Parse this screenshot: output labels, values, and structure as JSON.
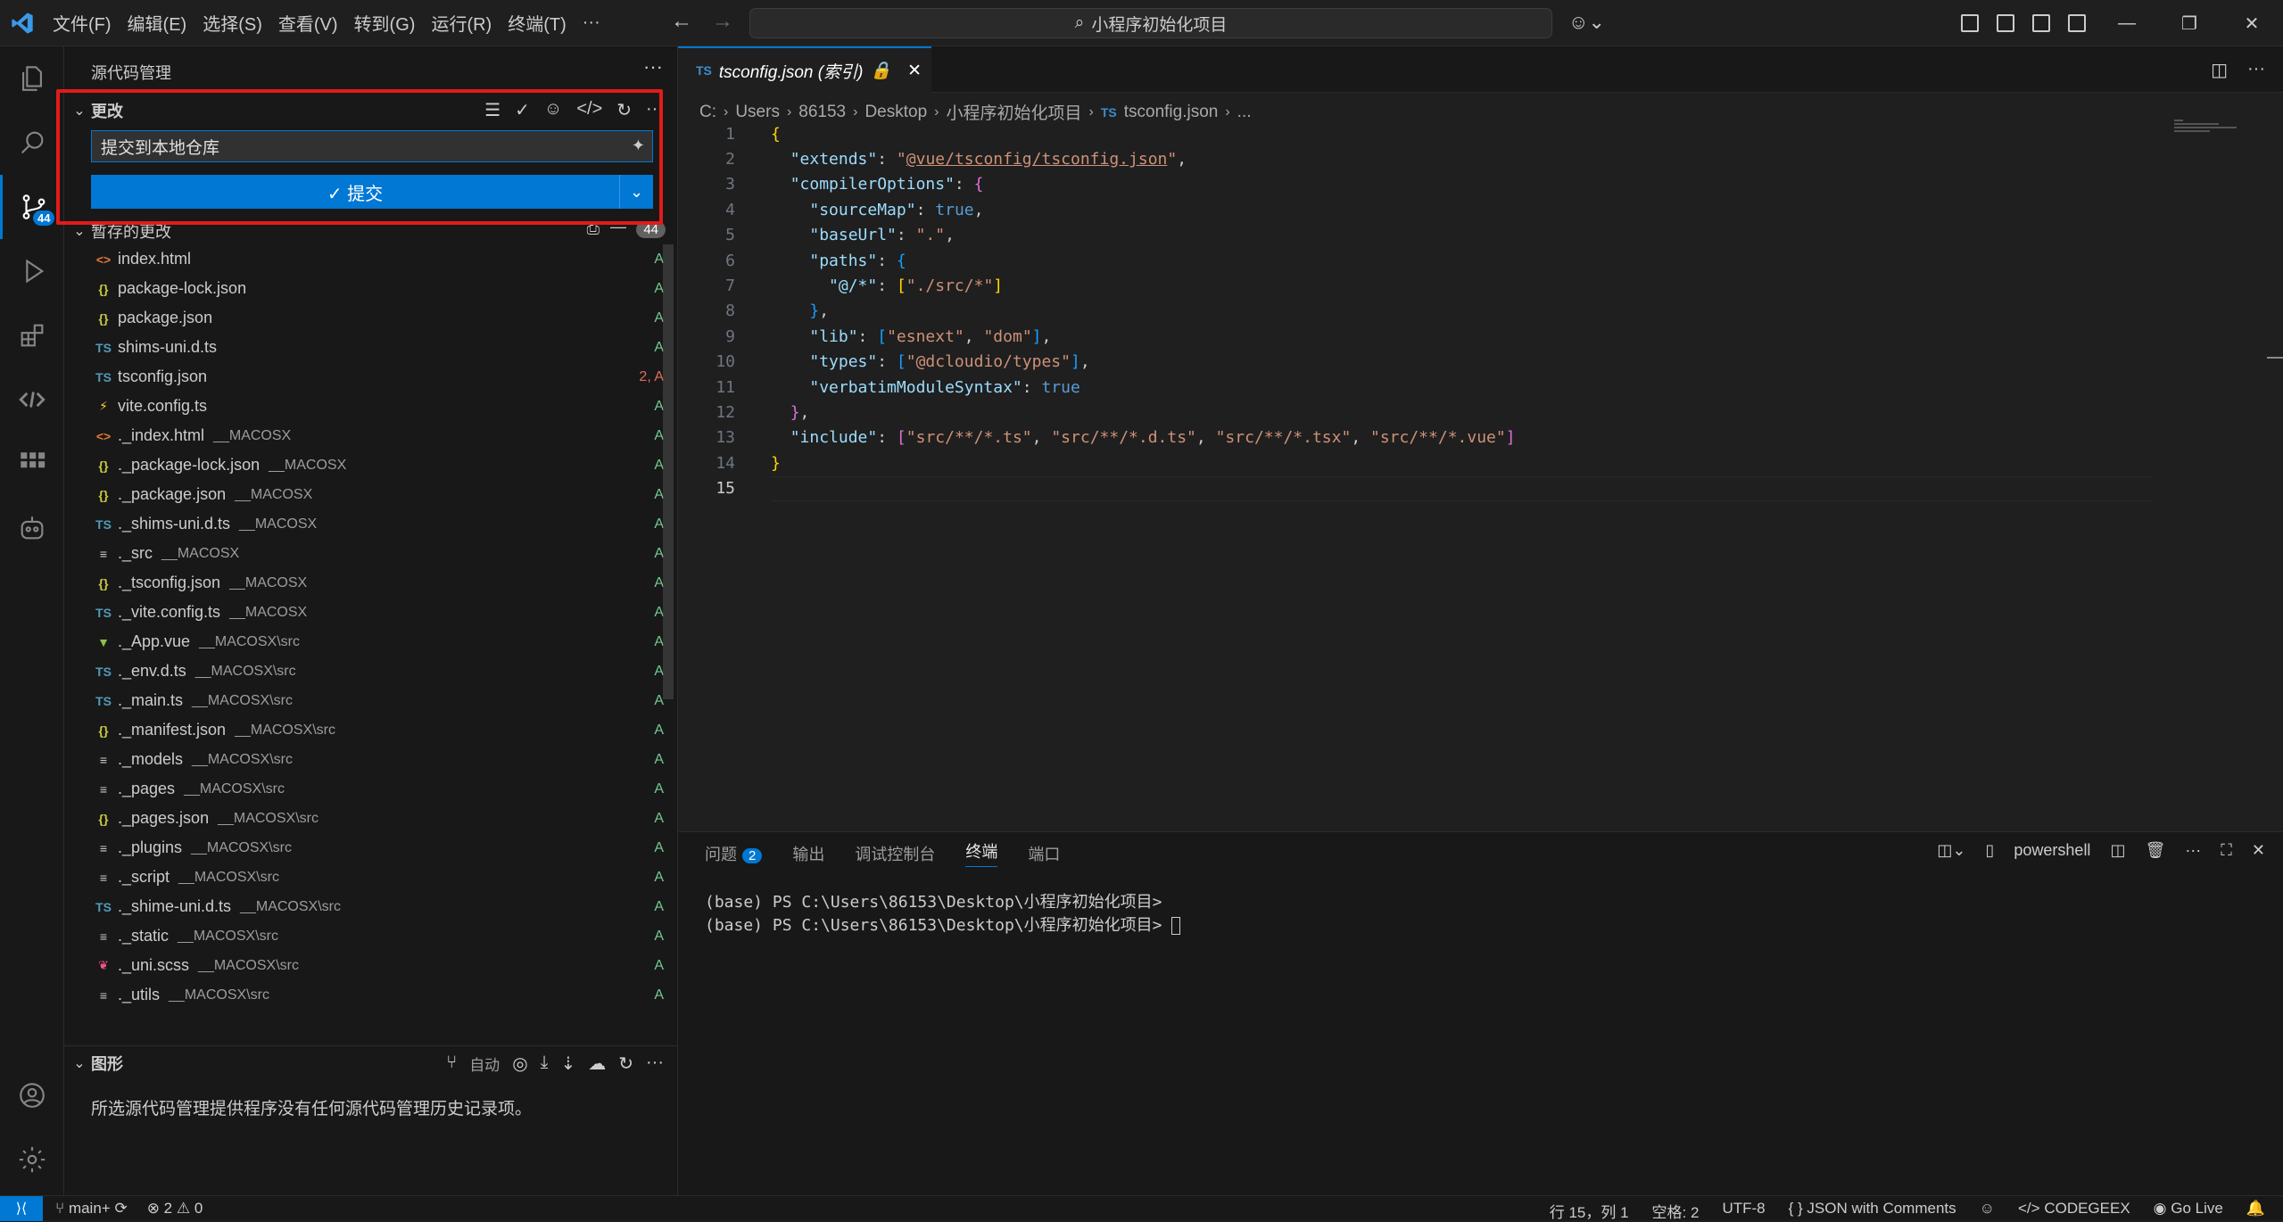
{
  "titlebar": {
    "menu": [
      "文件(F)",
      "编辑(E)",
      "选择(S)",
      "查看(V)",
      "转到(G)",
      "运行(R)",
      "终端(T)",
      "···"
    ],
    "search": "小程序初始化项目"
  },
  "activity": {
    "scm_badge": "44"
  },
  "sidebar": {
    "title": "源代码管理",
    "changes_label": "更改",
    "commit_message": "提交到本地仓库",
    "commit_button": "✓ 提交",
    "staged_label": "暂存的更改",
    "staged_count": "44",
    "files": [
      {
        "icon": "<>",
        "color": "#e37933",
        "name": "index.html",
        "path": "",
        "status": "A"
      },
      {
        "icon": "{}",
        "color": "#cbcb41",
        "name": "package-lock.json",
        "path": "",
        "status": "A"
      },
      {
        "icon": "{}",
        "color": "#cbcb41",
        "name": "package.json",
        "path": "",
        "status": "A"
      },
      {
        "icon": "TS",
        "color": "#519aba",
        "name": "shims-uni.d.ts",
        "path": "",
        "status": "A"
      },
      {
        "icon": "TS",
        "color": "#519aba",
        "name": "tsconfig.json",
        "path": "",
        "status": "2, A"
      },
      {
        "icon": "⚡",
        "color": "#ffcb2b",
        "name": "vite.config.ts",
        "path": "",
        "status": "A"
      },
      {
        "icon": "<>",
        "color": "#e37933",
        "name": "._index.html",
        "path": "__MACOSX",
        "status": "A"
      },
      {
        "icon": "{}",
        "color": "#cbcb41",
        "name": "._package-lock.json",
        "path": "__MACOSX",
        "status": "A"
      },
      {
        "icon": "{}",
        "color": "#cbcb41",
        "name": "._package.json",
        "path": "__MACOSX",
        "status": "A"
      },
      {
        "icon": "TS",
        "color": "#519aba",
        "name": "._shims-uni.d.ts",
        "path": "__MACOSX",
        "status": "A"
      },
      {
        "icon": "≡",
        "color": "#cccccc",
        "name": "._src",
        "path": "__MACOSX",
        "status": "A"
      },
      {
        "icon": "{}",
        "color": "#cbcb41",
        "name": "._tsconfig.json",
        "path": "__MACOSX",
        "status": "A"
      },
      {
        "icon": "TS",
        "color": "#519aba",
        "name": "._vite.config.ts",
        "path": "__MACOSX",
        "status": "A"
      },
      {
        "icon": "▼",
        "color": "#8dc149",
        "name": "._App.vue",
        "path": "__MACOSX\\src",
        "status": "A"
      },
      {
        "icon": "TS",
        "color": "#519aba",
        "name": "._env.d.ts",
        "path": "__MACOSX\\src",
        "status": "A"
      },
      {
        "icon": "TS",
        "color": "#519aba",
        "name": "._main.ts",
        "path": "__MACOSX\\src",
        "status": "A"
      },
      {
        "icon": "{}",
        "color": "#cbcb41",
        "name": "._manifest.json",
        "path": "__MACOSX\\src",
        "status": "A"
      },
      {
        "icon": "≡",
        "color": "#cccccc",
        "name": "._models",
        "path": "__MACOSX\\src",
        "status": "A"
      },
      {
        "icon": "≡",
        "color": "#cccccc",
        "name": "._pages",
        "path": "__MACOSX\\src",
        "status": "A"
      },
      {
        "icon": "{}",
        "color": "#cbcb41",
        "name": "._pages.json",
        "path": "__MACOSX\\src",
        "status": "A"
      },
      {
        "icon": "≡",
        "color": "#cccccc",
        "name": "._plugins",
        "path": "__MACOSX\\src",
        "status": "A"
      },
      {
        "icon": "≡",
        "color": "#cccccc",
        "name": "._script",
        "path": "__MACOSX\\src",
        "status": "A"
      },
      {
        "icon": "TS",
        "color": "#519aba",
        "name": "._shime-uni.d.ts",
        "path": "__MACOSX\\src",
        "status": "A"
      },
      {
        "icon": "≡",
        "color": "#cccccc",
        "name": "._static",
        "path": "__MACOSX\\src",
        "status": "A"
      },
      {
        "icon": "❦",
        "color": "#f55385",
        "name": "._uni.scss",
        "path": "__MACOSX\\src",
        "status": "A"
      },
      {
        "icon": "≡",
        "color": "#cccccc",
        "name": "._utils",
        "path": "__MACOSX\\src",
        "status": "A"
      }
    ],
    "graph_label": "图形",
    "graph_auto": "自动",
    "graph_message": "所选源代码管理提供程序没有任何源代码管理历史记录项。"
  },
  "editor": {
    "tab_label": "tsconfig.json (索引)",
    "breadcrumb": [
      "C:",
      "Users",
      "86153",
      "Desktop",
      "小程序初始化项目",
      "tsconfig.json",
      "..."
    ],
    "line_numbers": [
      "1",
      "2",
      "3",
      "4",
      "5",
      "6",
      "7",
      "8",
      "9",
      "10",
      "11",
      "12",
      "13",
      "14",
      "15"
    ]
  },
  "panel": {
    "tabs": [
      "问题",
      "输出",
      "调试控制台",
      "终端",
      "端口"
    ],
    "problems_count": "2",
    "shell": "powershell",
    "terminal_lines": [
      "(base) PS C:\\Users\\86153\\Desktop\\小程序初始化项目>",
      "(base) PS C:\\Users\\86153\\Desktop\\小程序初始化项目> "
    ]
  },
  "statusbar": {
    "branch": "main+",
    "errors": "2",
    "warnings": "0",
    "position": "行 15，列 1",
    "spaces": "空格: 2",
    "encoding": "UTF-8",
    "language": "{ } JSON with Comments",
    "codegeex": "CODEGEEX",
    "golive": "Go Live"
  },
  "colors": {
    "accent": "#0078d4",
    "highlight": "#e31b1b"
  }
}
